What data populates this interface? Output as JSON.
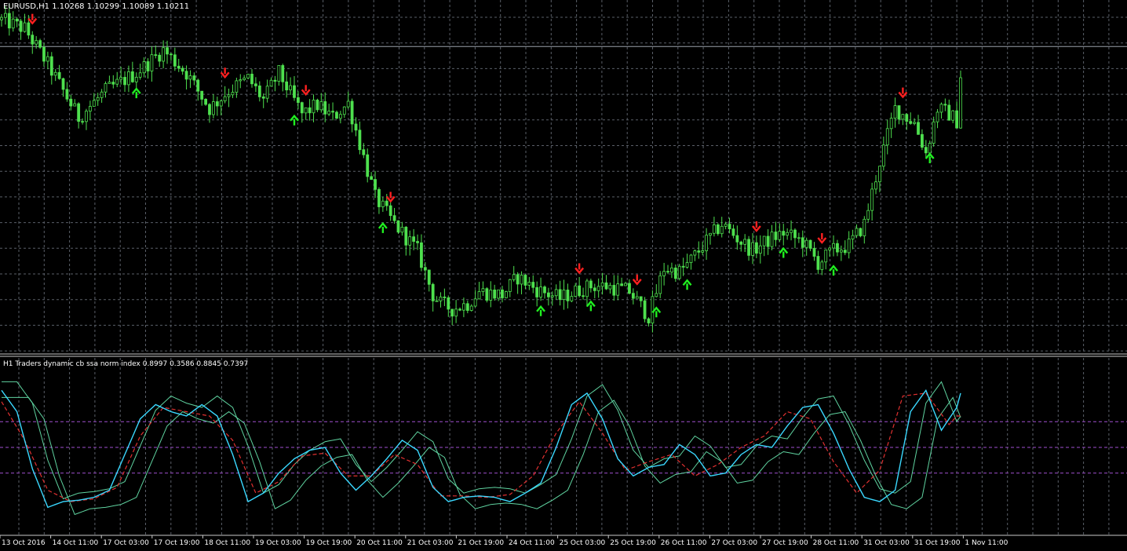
{
  "colors": {
    "background": "#000000",
    "grid": "#5a5f68",
    "candle_up": "#4ee04e",
    "candle_down": "#4ee04e",
    "text": "#ffffff",
    "arrow_up": "#20f020",
    "arrow_down": "#ff2020",
    "level_line": "#9aa0aa",
    "osc_fast": "#3ad8ff",
    "osc_signal": "#e03030",
    "osc_upper": "#5fd3a0",
    "osc_lower": "#5fd3a0",
    "osc_levels": "#a050d0"
  },
  "main": {
    "header": "EURUSD,H1  1.10268 1.10299 1.10089 1.10211",
    "symbol": "EURUSD",
    "timeframe": "H1",
    "ohlc": {
      "open": 1.10268,
      "high": 1.10299,
      "low": 1.10089,
      "close": 1.10211
    }
  },
  "indicator": {
    "header": "H1  Traders dynamic cb ssa norm index 0.8997 0.3586 0.8845 0.7397",
    "values": [
      0.8997,
      0.3586,
      0.8845,
      0.7397
    ],
    "levels": [
      0.68,
      0.5,
      0.32
    ],
    "ylim": [
      -0.05,
      1.05
    ]
  },
  "time_axis": {
    "labels": [
      "13 Oct 2016",
      "14 Oct 11:00",
      "17 Oct 03:00",
      "17 Oct 19:00",
      "18 Oct 11:00",
      "19 Oct 03:00",
      "19 Oct 19:00",
      "20 Oct 11:00",
      "21 Oct 03:00",
      "21 Oct 19:00",
      "24 Oct 11:00",
      "25 Oct 03:00",
      "25 Oct 19:00",
      "26 Oct 11:00",
      "27 Oct 03:00",
      "27 Oct 19:00",
      "28 Oct 11:00",
      "31 Oct 03:00",
      "31 Oct 19:00",
      "1 Nov 11:00"
    ]
  },
  "chart_data": {
    "type": "line",
    "title": "EURUSD,H1",
    "xlabel": "",
    "ylabel": "",
    "grid": true,
    "x_bar_count": 250,
    "ylim": [
      1.0848,
      1.104
    ],
    "price_path": {
      "bar_index": [
        0,
        6,
        12,
        20,
        27,
        35,
        42,
        48,
        54,
        59,
        64,
        68,
        72,
        78,
        82,
        86,
        90,
        97,
        102,
        108,
        112,
        114,
        117,
        121,
        124,
        130,
        134,
        139,
        145,
        149,
        153,
        157,
        163,
        168,
        172,
        176,
        178,
        183,
        187,
        192,
        195,
        200,
        203,
        208,
        212,
        216,
        220,
        224,
        228,
        232,
        237,
        240,
        243,
        246,
        248,
        250
      ],
      "close": [
        1.1035,
        1.103,
        1.101,
        1.098,
        1.0995,
        1.1005,
        1.1018,
        1.1005,
        1.0985,
        1.0995,
        1.1002,
        1.099,
        1.1005,
        1.0982,
        1.0987,
        1.098,
        1.0988,
        1.0935,
        1.092,
        1.0905,
        1.088,
        1.0875,
        1.0872,
        1.0875,
        1.0882,
        1.088,
        1.089,
        1.0883,
        1.0878,
        1.0882,
        1.0885,
        1.0885,
        1.0882,
        1.0868,
        1.0895,
        1.0893,
        1.0897,
        1.091,
        1.092,
        1.091,
        1.0905,
        1.0912,
        1.0915,
        1.091,
        1.0898,
        1.0905,
        1.0908,
        1.092,
        1.0955,
        1.0985,
        1.0977,
        1.096,
        1.0985,
        1.0982,
        1.0978,
        1.103
      ]
    },
    "level_line": 1.102,
    "arrows": {
      "up": [
        35,
        76,
        99,
        140,
        153,
        170,
        178,
        203,
        216,
        241
      ],
      "down": [
        8,
        58,
        79,
        101,
        150,
        165,
        196,
        213,
        234
      ]
    },
    "oscillator": {
      "series": [
        {
          "key": "fast",
          "bar_index": [
            0,
            4,
            8,
            12,
            16,
            20,
            24,
            28,
            32,
            36,
            40,
            44,
            48,
            52,
            56,
            60,
            64,
            68,
            72,
            76,
            80,
            84,
            88,
            92,
            96,
            100,
            104,
            108,
            112,
            116,
            120,
            124,
            128,
            132,
            136,
            140,
            144,
            148,
            152,
            156,
            160,
            164,
            168,
            172,
            176,
            180,
            184,
            188,
            192,
            196,
            200,
            204,
            208,
            212,
            216,
            220,
            224,
            228,
            232,
            236,
            240,
            244,
            248
          ],
          "values": [
            0.9,
            0.75,
            0.35,
            0.08,
            0.12,
            0.13,
            0.15,
            0.2,
            0.45,
            0.7,
            0.8,
            0.75,
            0.72,
            0.8,
            0.72,
            0.45,
            0.12,
            0.18,
            0.32,
            0.42,
            0.48,
            0.5,
            0.32,
            0.2,
            0.3,
            0.42,
            0.55,
            0.48,
            0.22,
            0.12,
            0.15,
            0.16,
            0.15,
            0.12,
            0.18,
            0.25,
            0.5,
            0.8,
            0.88,
            0.7,
            0.42,
            0.3,
            0.36,
            0.38,
            0.52,
            0.45,
            0.3,
            0.32,
            0.45,
            0.52,
            0.5,
            0.65,
            0.78,
            0.8,
            0.6,
            0.35,
            0.15,
            0.12,
            0.2,
            0.75,
            0.9,
            0.62,
            0.78,
            0.82,
            0.55,
            0.35,
            0.5,
            0.88
          ]
        },
        {
          "key": "signal",
          "bar_index": [
            0,
            6,
            12,
            18,
            24,
            30,
            36,
            42,
            48,
            54,
            60,
            66,
            72,
            78,
            84,
            90,
            96,
            102,
            108,
            114,
            120,
            126,
            132,
            138,
            144,
            150,
            156,
            162,
            168,
            174,
            180,
            186,
            192,
            198,
            204,
            210,
            216,
            222,
            228,
            234,
            240,
            246,
            248
          ],
          "values": [
            0.82,
            0.55,
            0.2,
            0.12,
            0.14,
            0.22,
            0.58,
            0.78,
            0.75,
            0.72,
            0.55,
            0.18,
            0.26,
            0.44,
            0.46,
            0.3,
            0.3,
            0.45,
            0.38,
            0.16,
            0.16,
            0.15,
            0.17,
            0.3,
            0.6,
            0.82,
            0.6,
            0.34,
            0.4,
            0.45,
            0.3,
            0.38,
            0.5,
            0.58,
            0.75,
            0.7,
            0.4,
            0.18,
            0.34,
            0.86,
            0.88,
            0.66,
            0.72
          ]
        }
      ]
    }
  }
}
